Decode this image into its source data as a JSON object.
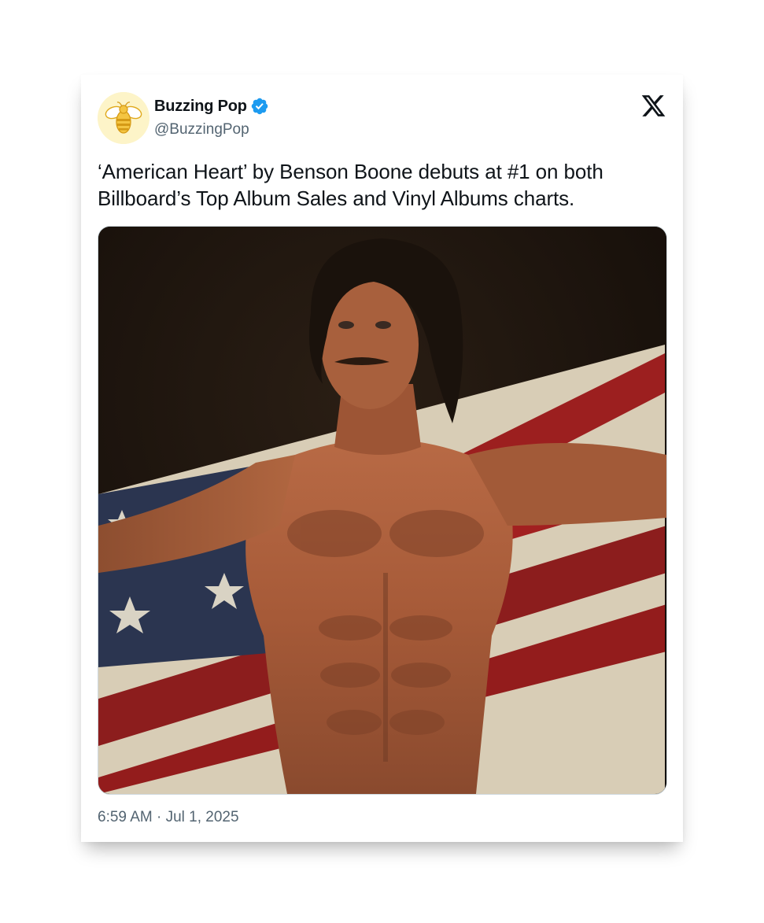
{
  "tweet": {
    "author": {
      "display_name": "Buzzing Pop",
      "handle": "@BuzzingPop",
      "verified": true,
      "avatar_icon": "bee-icon",
      "verified_icon": "verified-badge-icon",
      "verified_color": "#1d9bf0"
    },
    "platform_icon": "x-logo-icon",
    "text": "‘American Heart’ by Benson Boone debuts at #1 on both Billboard’s Top Album Sales and Vinyl Albums charts.",
    "media": {
      "alt": "Shirtless man with curly hair holding an American flag behind him"
    },
    "time": "6:59 AM",
    "separator": "·",
    "date": "Jul 1, 2025"
  },
  "colors": {
    "text_primary": "#0f1419",
    "text_secondary": "#536471",
    "background": "#ffffff"
  }
}
